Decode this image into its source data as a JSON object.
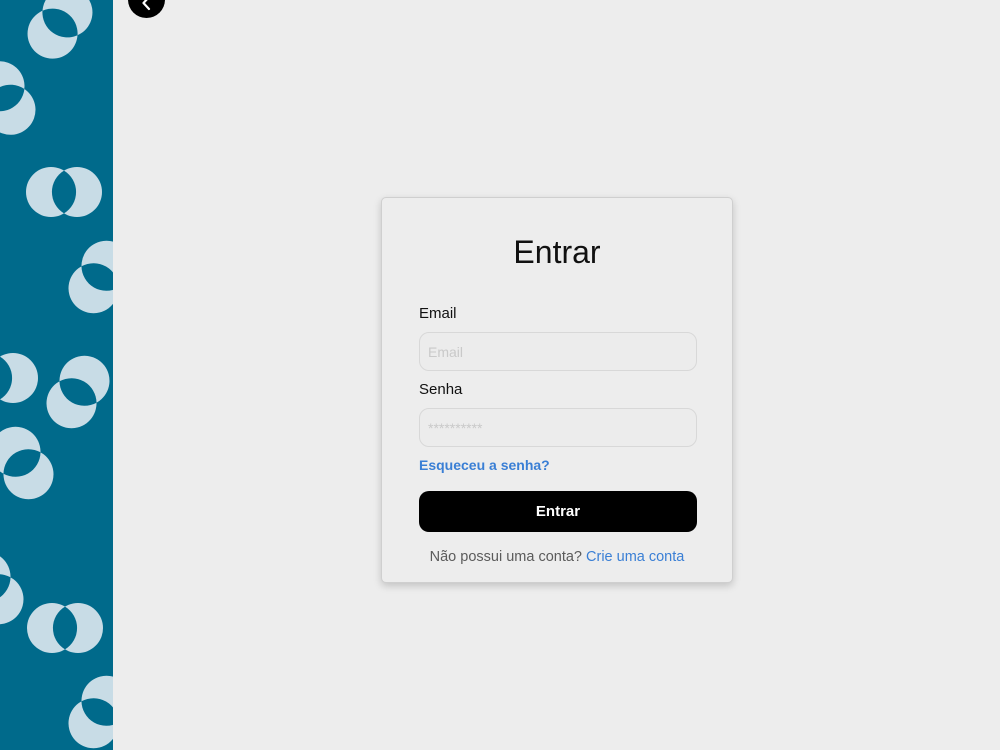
{
  "colors": {
    "sidebar_bg": "#006a8b",
    "pattern_fill": "#c8dce6",
    "page_bg": "#ededed",
    "link": "#3a7fd5",
    "button_bg": "#000000"
  },
  "icons": {
    "back": "chevron-left-icon",
    "pattern": "overlapping-circles-pattern"
  },
  "login": {
    "title": "Entrar",
    "email_label": "Email",
    "email_placeholder": "Email",
    "email_value": "",
    "password_label": "Senha",
    "password_placeholder": "**********",
    "password_value": "",
    "forgot_link": "Esqueceu a senha?",
    "submit_label": "Entrar",
    "signup_prompt": "Não possui uma conta?",
    "signup_link": "Crie uma conta"
  }
}
